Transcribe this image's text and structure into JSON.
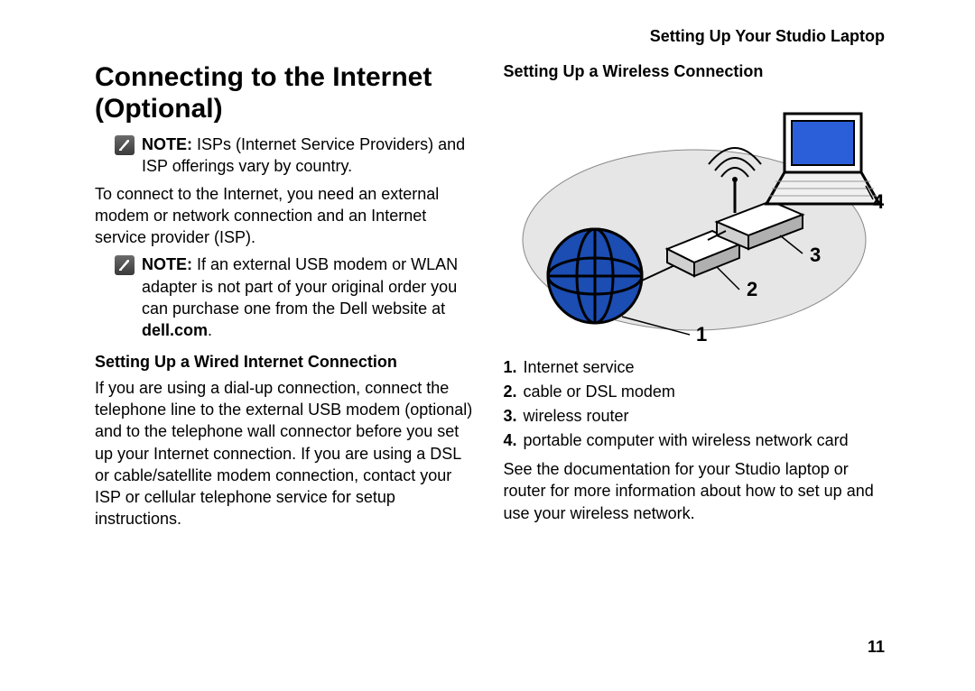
{
  "header": {
    "section_title": "Setting Up Your Studio Laptop"
  },
  "left": {
    "title_line1": "Connecting to the Internet",
    "title_line2": "(Optional)",
    "note1_label": "NOTE:",
    "note1_text": " ISPs (Internet Service Providers) and ISP offerings vary by country.",
    "para1": "To connect to the Internet, you need an external modem or network connection and an Internet service provider (ISP).",
    "note2_label": "NOTE:",
    "note2_text_a": " If an external USB modem or WLAN adapter is not part of your original order you can purchase one from the Dell website at ",
    "note2_bold": "dell.com",
    "note2_text_b": ".",
    "subhead": "Setting Up a Wired Internet Connection",
    "para2": "If you are using a dial-up connection, connect the telephone line to the external USB modem (optional) and to the telephone wall connector before you set up your Internet connection. If you are using a DSL or cable/satellite modem connection, contact your ISP or cellular telephone service for setup instructions."
  },
  "right": {
    "subhead": "Setting Up a Wireless Connection",
    "diagram_labels": {
      "l1": "1",
      "l2": "2",
      "l3": "3",
      "l4": "4"
    },
    "legend": [
      {
        "num": "1.",
        "text": "Internet service"
      },
      {
        "num": "2.",
        "text": "cable or DSL modem"
      },
      {
        "num": "3.",
        "text": "wireless router"
      },
      {
        "num": "4.",
        "text": "portable computer with wireless network card"
      }
    ],
    "para1": "See the documentation for your Studio laptop or router for more information about how to set up and use your wireless network."
  },
  "page_number": "11"
}
